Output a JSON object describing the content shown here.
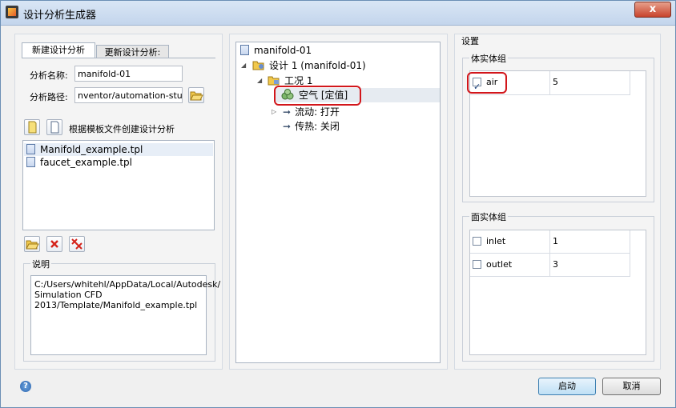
{
  "window": {
    "title": "设计分析生成器",
    "close": "x"
  },
  "tabs": {
    "new": "新建设计分析",
    "update": "更新设计分析:"
  },
  "form": {
    "name_label": "分析名称:",
    "name_value": "manifold-01",
    "path_label": "分析路径:",
    "path_value": "nventor/automation-study"
  },
  "template": {
    "create_label": "根据模板文件创建设计分析",
    "files": [
      "Manifold_example.tpl",
      "faucet_example.tpl"
    ]
  },
  "description": {
    "title": "说明",
    "text_lines": [
      "C:/Users/whitehl/AppData/Local/Autodesk/",
      "Simulation CFD",
      "2013/Template/Manifold_example.tpl"
    ]
  },
  "tree": {
    "root": "manifold-01",
    "design": "设计 1 (manifold-01)",
    "scenario": "工况 1",
    "material": "空气 [定值]",
    "flow": "流动: 打开",
    "heat": "传热: 关闭"
  },
  "settings": {
    "title": "设置",
    "volume_group": "体实体组",
    "volume_rows": [
      {
        "name": "air",
        "value": "5",
        "checked": true
      }
    ],
    "surface_group": "面实体组",
    "surface_rows": [
      {
        "name": "inlet",
        "value": "1",
        "checked": false
      },
      {
        "name": "outlet",
        "value": "3",
        "checked": false
      }
    ]
  },
  "buttons": {
    "start": "启动",
    "cancel": "取消"
  },
  "help": "?"
}
